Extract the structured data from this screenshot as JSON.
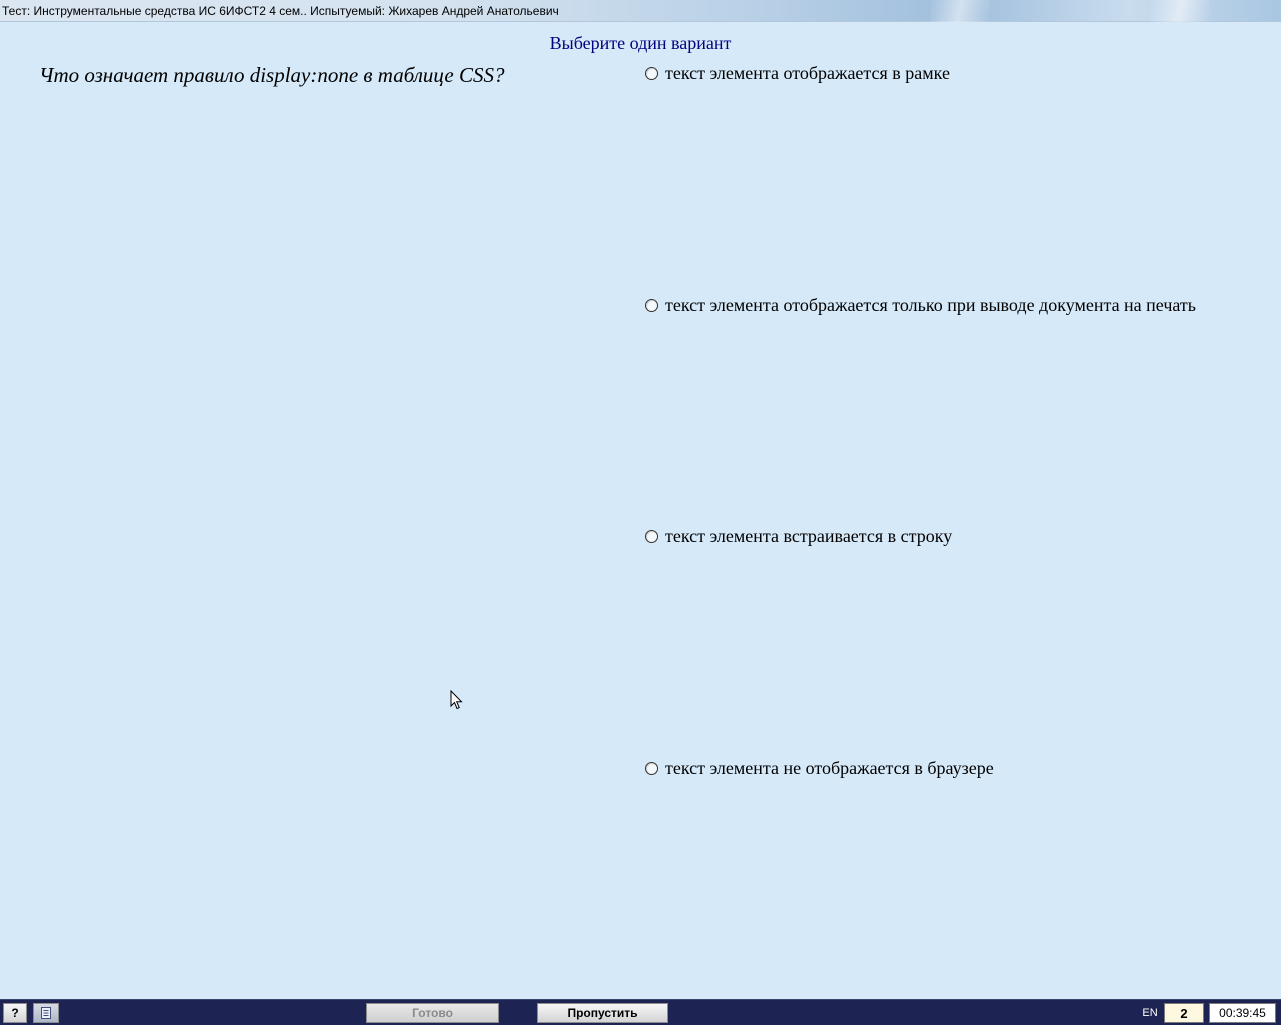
{
  "window": {
    "title": "Тест: Инструментальные средства ИС 6ИФСТ2 4 сем.. Испытуемый: Жихарев Андрей Анатольевич"
  },
  "instruction": "Выберите один вариант",
  "question": "Что означает правило display:none в таблице CSS?",
  "options": [
    {
      "label": "текст элемента отображается в рамке",
      "selected": false
    },
    {
      "label": "текст элемента отображается только при выводе документа на печать",
      "selected": false
    },
    {
      "label": "текст элемента встраивается в строку",
      "selected": false
    },
    {
      "label": "текст элемента не отображается в браузере",
      "selected": false
    }
  ],
  "taskbar": {
    "help_label": "?",
    "done_label": "Готово",
    "done_enabled": false,
    "skip_label": "Пропустить",
    "language": "EN",
    "question_number": "2",
    "timer": "00:39:45"
  },
  "colors": {
    "background": "#d6e9f8",
    "instruction_text": "#000080",
    "taskbar": "#1d2352"
  }
}
